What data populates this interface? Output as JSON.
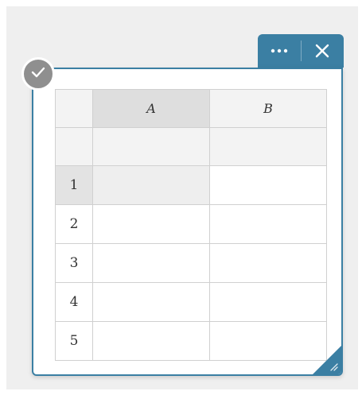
{
  "toolbar": {
    "more_icon": "more-horizontal-icon",
    "close_icon": "close-icon"
  },
  "badge": {
    "icon": "check-icon"
  },
  "spreadsheet": {
    "columns": [
      "A",
      "B"
    ],
    "rows": [
      "1",
      "2",
      "3",
      "4",
      "5"
    ],
    "selected_cell": "A1"
  },
  "colors": {
    "accent": "#3b7fa3",
    "badge": "#8f8f8f",
    "header_bg": "#f3f3f3",
    "selected_header_bg": "#dedede"
  }
}
